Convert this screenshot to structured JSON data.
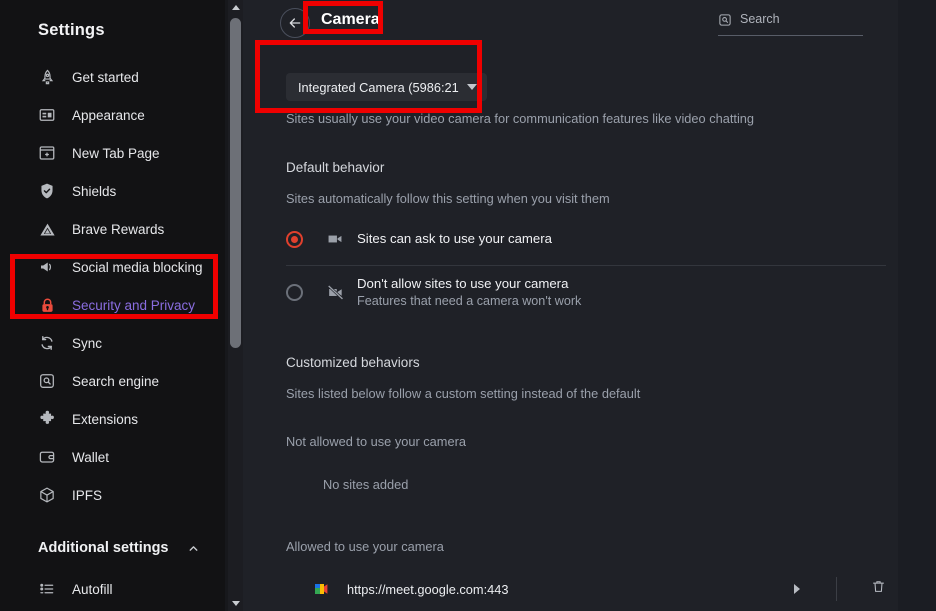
{
  "sidebar": {
    "title": "Settings",
    "items": [
      {
        "label": "Get started",
        "icon": "rocket-icon",
        "active": false
      },
      {
        "label": "Appearance",
        "icon": "appearance-icon",
        "active": false
      },
      {
        "label": "New Tab Page",
        "icon": "new-tab-page-icon",
        "active": false
      },
      {
        "label": "Shields",
        "icon": "shield-check-icon",
        "active": false
      },
      {
        "label": "Brave Rewards",
        "icon": "brave-triangle-icon",
        "active": false
      },
      {
        "label": "Social media blocking",
        "icon": "megaphone-icon",
        "active": false
      },
      {
        "label": "Security and Privacy",
        "icon": "lock-icon",
        "active": true
      },
      {
        "label": "Sync",
        "icon": "sync-icon",
        "active": false
      },
      {
        "label": "Search engine",
        "icon": "search-square-icon",
        "active": false
      },
      {
        "label": "Extensions",
        "icon": "puzzle-icon",
        "active": false
      },
      {
        "label": "Wallet",
        "icon": "wallet-icon",
        "active": false
      },
      {
        "label": "IPFS",
        "icon": "cube-icon",
        "active": false
      }
    ],
    "additional_section": {
      "label": "Additional settings",
      "caret": "chevron-up-icon",
      "items": [
        {
          "label": "Autofill",
          "icon": "list-icon"
        }
      ]
    },
    "active_color": "#8a6de0",
    "active_icon_color": "#eb4b3c"
  },
  "scrollbar": {
    "up_arrow": "scroll-up-arrow-icon",
    "down_arrow": "scroll-down-arrow-icon"
  },
  "header": {
    "back_icon": "back-arrow-icon",
    "title": "Camera",
    "search": {
      "icon": "search-icon",
      "placeholder": "Search",
      "value": ""
    }
  },
  "main": {
    "device_select": {
      "value": "Integrated Camera (5986:21",
      "caret": "chevron-down-icon"
    },
    "intro_text": "Sites usually use your video camera for communication features like video chatting",
    "default_behavior": {
      "title": "Default behavior",
      "subtitle": "Sites automatically follow this setting when you visit them",
      "options": [
        {
          "label": "Sites can ask to use your camera",
          "sublabel": "",
          "icon": "camera-icon",
          "selected": true
        },
        {
          "label": "Don't allow sites to use your camera",
          "sublabel": "Features that need a camera won't work",
          "icon": "camera-off-icon",
          "selected": false
        }
      ]
    },
    "customized_behaviors": {
      "title": "Customized behaviors",
      "subtitle": "Sites listed below follow a custom setting instead of the default",
      "not_allowed": {
        "title": "Not allowed to use your camera",
        "empty_text": "No sites added"
      },
      "allowed": {
        "title": "Allowed to use your camera",
        "sites": [
          {
            "url": "https://meet.google.com:443",
            "favicon": "google-meet-favicon",
            "expand_icon": "chevron-right-icon",
            "delete_icon": "trash-icon"
          }
        ]
      }
    }
  },
  "annotations": {
    "highlight_color": "#ef0000",
    "boxes": [
      {
        "name": "camera-title-highlight"
      },
      {
        "name": "device-select-highlight"
      },
      {
        "name": "security-privacy-highlight"
      }
    ]
  }
}
